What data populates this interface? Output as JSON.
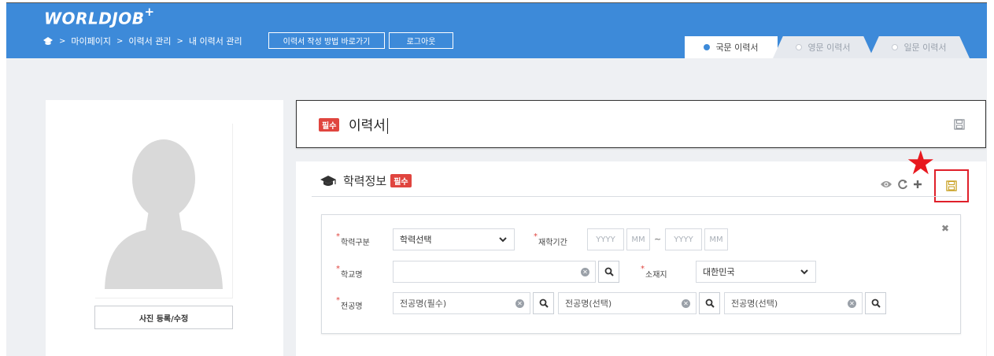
{
  "app": {
    "logo_text": "WORLDJOB",
    "logo_plus": "+"
  },
  "breadcrumb": {
    "items": [
      "마이페이지",
      "이력서 관리",
      "내 이력서 관리"
    ],
    "separator": ">"
  },
  "header_buttons": {
    "guide": "이력서 작성 방법 바로가기",
    "logout": "로그아웃"
  },
  "tabs": [
    {
      "label": "국문 이력서",
      "active": true
    },
    {
      "label": "영문 이력서",
      "active": false
    },
    {
      "label": "일문 이력서",
      "active": false
    }
  ],
  "photo": {
    "button_label": "사진 등록/수정"
  },
  "resume_title": {
    "badge": "필수",
    "value": "이력서"
  },
  "education": {
    "title": "학력정보",
    "badge": "필수",
    "form": {
      "degree_label": "학력구분",
      "degree_value": "학력선택",
      "period_label": "재학기간",
      "period_start_year": "YYYY",
      "period_start_month": "MM",
      "period_tilde": "~",
      "period_end_year": "YYYY",
      "period_end_month": "MM",
      "school_label": "학교명",
      "school_value": "",
      "location_label": "소재지",
      "location_value": "대한민국",
      "major_label": "전공명",
      "major_1": "전공명(필수)",
      "major_2": "전공명(선택)",
      "major_3": "전공명(선택)"
    }
  },
  "colors": {
    "header": "#3d8ad9",
    "required": "#e0453f",
    "highlight": "#e0202a",
    "star": "#e8191f"
  }
}
